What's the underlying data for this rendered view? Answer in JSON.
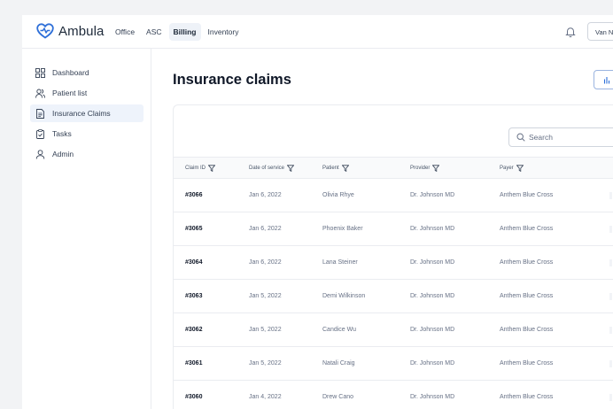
{
  "app": {
    "name": "Ambula",
    "brand_color": "#2e6fd8"
  },
  "header": {
    "nav": [
      {
        "label": "Office",
        "active": false
      },
      {
        "label": "ASC",
        "active": false
      },
      {
        "label": "Billing",
        "active": true
      },
      {
        "label": "Inventory",
        "active": false
      }
    ],
    "user_label": "Van N"
  },
  "sidebar": {
    "items": [
      {
        "label": "Dashboard",
        "icon": "grid-icon",
        "active": false
      },
      {
        "label": "Patient list",
        "icon": "users-icon",
        "active": false
      },
      {
        "label": "Insurance Claims",
        "icon": "document-icon",
        "active": true
      },
      {
        "label": "Tasks",
        "icon": "clipboard-check-icon",
        "active": false
      },
      {
        "label": "Admin",
        "icon": "user-icon",
        "active": false
      }
    ]
  },
  "main": {
    "title": "Insurance claims",
    "search": {
      "placeholder": "Search"
    },
    "table": {
      "columns": [
        "Claim ID",
        "Date of service",
        "Patient",
        "Provider",
        "Payer"
      ],
      "rows": [
        [
          "#3066",
          "Jan 6, 2022",
          "Olivia Rhye",
          "Dr. Johnson MD",
          "Anthem Blue Cross"
        ],
        [
          "#3065",
          "Jan 6, 2022",
          "Phoenix Baker",
          "Dr. Johnson MD",
          "Anthem Blue Cross"
        ],
        [
          "#3064",
          "Jan 6, 2022",
          "Lana Steiner",
          "Dr. Johnson MD",
          "Anthem Blue Cross"
        ],
        [
          "#3063",
          "Jan 5, 2022",
          "Demi Wilkinson",
          "Dr. Johnson MD",
          "Anthem Blue Cross"
        ],
        [
          "#3062",
          "Jan 5, 2022",
          "Candice Wu",
          "Dr. Johnson MD",
          "Anthem Blue Cross"
        ],
        [
          "#3061",
          "Jan 5, 2022",
          "Natali Craig",
          "Dr. Johnson MD",
          "Anthem Blue Cross"
        ],
        [
          "#3060",
          "Jan 4, 2022",
          "Drew Cano",
          "Dr. Johnson MD",
          "Anthem Blue Cross"
        ]
      ]
    }
  }
}
